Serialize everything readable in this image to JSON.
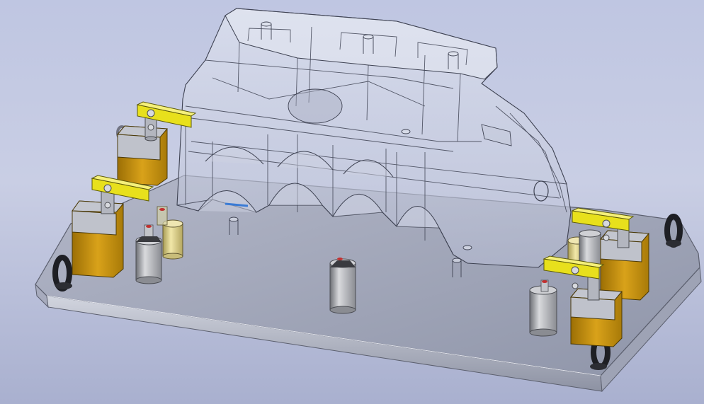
{
  "viewport": {
    "background_top": "#bfc6e2",
    "background_bottom": "#a9b0cf"
  },
  "scene": {
    "description_visible_text": "",
    "components": {
      "base_plate": {
        "color": "#9fa4b6",
        "edge_color": "#c3c6d2"
      },
      "transparent_part": {
        "color": "#d6dbe8",
        "opacity": 0.55,
        "edge_color": "#3e4252"
      },
      "clamp_bodies": {
        "count": 4,
        "color": "#c8940f",
        "cap_color": "#b9bcc6"
      },
      "clamp_arms": {
        "count": 4,
        "color": "#e8e01c"
      },
      "locating_pins": {
        "count": 5,
        "color": "#a7a9ae"
      },
      "lifting_rings": {
        "count": 4,
        "color": "#222328"
      },
      "yellow_support": {
        "count": 2,
        "color": "#e1d27c"
      }
    }
  }
}
